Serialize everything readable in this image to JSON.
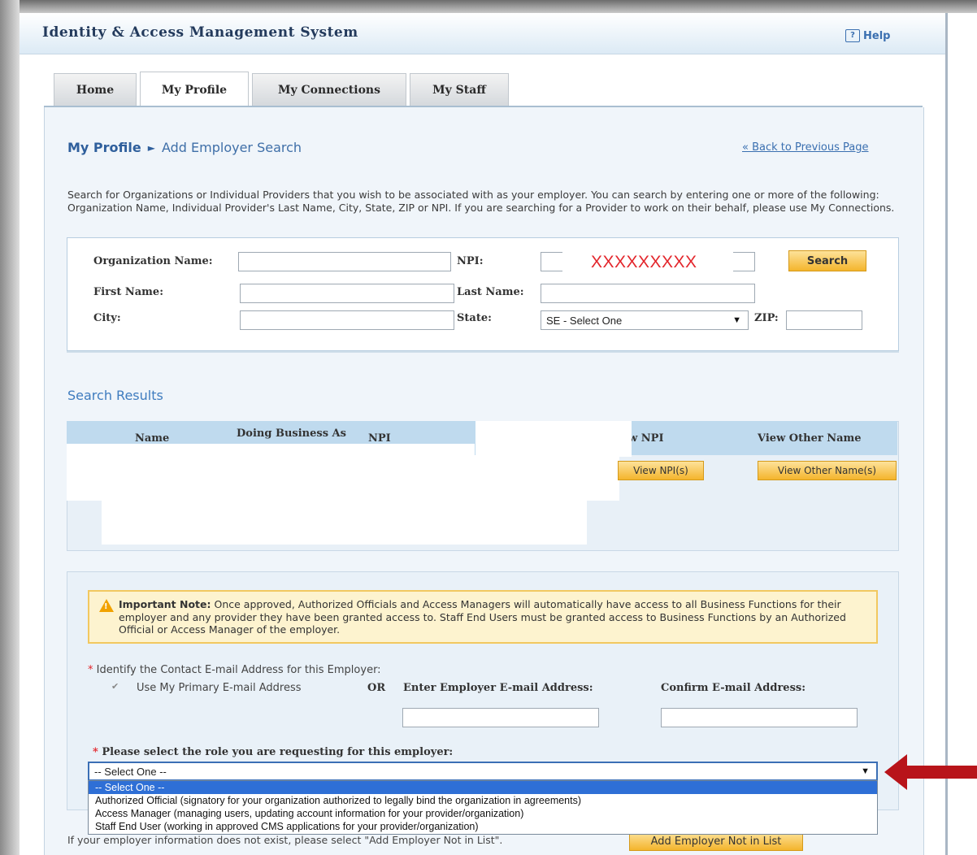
{
  "app": {
    "title": "Identity & Access Management System",
    "help_label": "Help",
    "help_glyph": "?"
  },
  "tabs": [
    {
      "label": "Home"
    },
    {
      "label": "My Profile"
    },
    {
      "label": "My Connections"
    },
    {
      "label": "My Staff"
    }
  ],
  "breadcrumb": {
    "parent": "My Profile",
    "current": "Add Employer Search",
    "separator": "►"
  },
  "back_link": "« Back to Previous Page",
  "instructions": "Search for Organizations or Individual Providers that you wish to be associated with as your employer. You can search by entering one or more of the following: Organization Name, Individual Provider's Last Name, City, State, ZIP or NPI. If you are searching for a Provider to work on their behalf, please use My Connections.",
  "search": {
    "org_name_label": "Organization Name:",
    "npi_label": "NPI:",
    "npi_value": "XXXXXXXXX",
    "search_button": "Search",
    "first_name_label": "First Name:",
    "last_name_label": "Last Name:",
    "city_label": "City:",
    "state_label": "State:",
    "state_value": "SE - Select One",
    "zip_label": "ZIP:"
  },
  "results": {
    "title": "Search Results",
    "columns": [
      "Name",
      "Doing Business As",
      "NPI",
      "View NPI",
      "View Other Name"
    ],
    "row_buttons": {
      "view_npi": "View NPI(s)",
      "view_other_name": "View Other Name(s)"
    }
  },
  "note": {
    "title": "Important Note:",
    "body": "Once approved, Authorized Officials and Access Managers will automatically have access to all Business Functions for their employer and any provider they have been granted access to. Staff End Users must be granted access to Business Functions by an Authorized Official or Access Manager of the employer.",
    "warn_glyph": "!"
  },
  "email": {
    "required_mark": "*",
    "prompt": "Identify the Contact E-mail Address for this Employer:",
    "checkbox_glyph": "✔",
    "use_primary_label": "Use My Primary E-mail Address",
    "or_label": "OR",
    "employer_email_label": "Enter Employer E-mail Address:",
    "confirm_email_label": "Confirm E-mail Address:"
  },
  "role": {
    "prompt": "Please select the role you are requesting for this employer:",
    "selected": "-- Select One --",
    "options": [
      "-- Select One --",
      "Authorized Official (signatory for your organization authorized to legally bind the organization in agreements)",
      "Access Manager (managing users, updating account information for your provider/organization)",
      "Staff End User (working in approved CMS applications for your provider/organization)"
    ]
  },
  "footer": {
    "text": "If your employer information does not exist, please select \"Add Employer Not in List\".",
    "button": "Add Employer Not in List"
  },
  "colors": {
    "accent_blue": "#2f5f9c",
    "button_gold": "#f4b52d",
    "annotation_red": "#b8141a",
    "npi_red": "#e3262c"
  },
  "icons": {
    "caret": "▼"
  }
}
